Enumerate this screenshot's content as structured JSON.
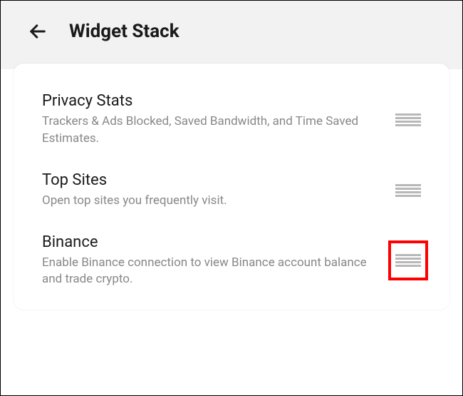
{
  "header": {
    "title": "Widget Stack"
  },
  "widgets": [
    {
      "title": "Privacy Stats",
      "description": "Trackers & Ads Blocked, Saved Bandwidth, and Time Saved Estimates."
    },
    {
      "title": "Top Sites",
      "description": "Open top sites you frequently visit."
    },
    {
      "title": "Binance",
      "description": "Enable Binance connection to view Binance account balance and trade crypto."
    }
  ]
}
